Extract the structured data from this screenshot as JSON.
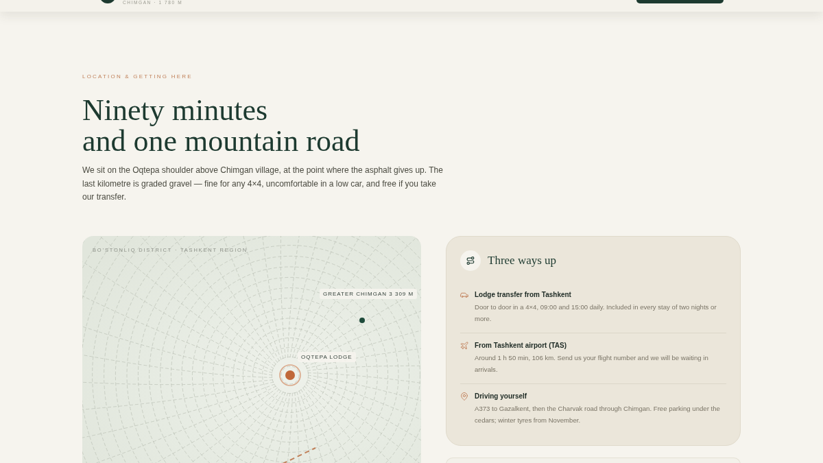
{
  "header": {
    "brand_subtitle": "CHIMGAN · 1 780 M"
  },
  "section": {
    "eyebrow": "LOCATION & GETTING HERE",
    "title_lines": [
      "Ninety minutes",
      "and one mountain road"
    ],
    "intro": "We sit on the Oqtepa shoulder above Chimgan village, at the point where the asphalt gives up. The last kilometre is graded gravel — fine for any 4×4, uncomfortable in a low car, and free if you take our transfer."
  },
  "map": {
    "region_label": "BO’STONLIQ DISTRICT · TASHKENT REGION",
    "markers": [
      {
        "kind": "peak",
        "label": "GREATER CHIMGAN 3 309 M"
      },
      {
        "kind": "lodge",
        "label": "OQTEPA LODGE"
      }
    ]
  },
  "directions": {
    "title": "Three ways up",
    "items": [
      {
        "kind": "car",
        "title": "Lodge transfer from Tashkent",
        "text": "Door to door in a 4×4, 09:00 and 15:00 daily. Included in every stay of two nights or more."
      },
      {
        "kind": "plane",
        "title": "From Tashkent airport (TAS)",
        "text": "Around 1 h 50 min, 106 km. Send us your flight number and we will be waiting in arrivals."
      },
      {
        "kind": "pin",
        "title": "Driving yourself",
        "text": "A373 to Gazalkent, then the Charvak road through Chimgan. Free parking under the cedars; winter tyres from November."
      }
    ]
  }
}
